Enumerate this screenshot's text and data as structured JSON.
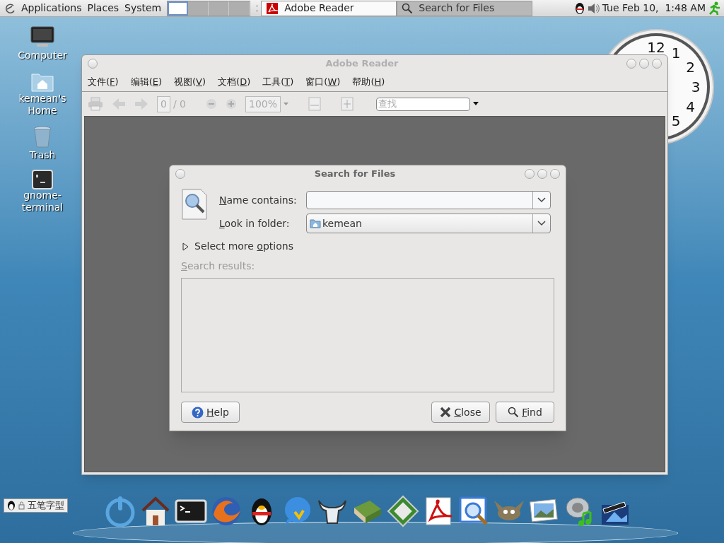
{
  "top_panel": {
    "menus": [
      {
        "label": "Applications"
      },
      {
        "label": "Places"
      },
      {
        "label": "System"
      }
    ],
    "workspaces": [
      {
        "selected": true
      },
      {
        "selected": false
      },
      {
        "selected": false
      },
      {
        "selected": false
      }
    ],
    "tasks": [
      {
        "label": "Adobe Reader",
        "kind": "pdf",
        "selected": false
      },
      {
        "label": "Search for Files",
        "kind": "search",
        "selected": true
      }
    ],
    "clock": "Tue Feb 10,  1:48 AM"
  },
  "desktop_icons": [
    {
      "label": "Computer",
      "kind": "computer"
    },
    {
      "label": "kemean's Home",
      "kind": "home"
    },
    {
      "label": "Trash",
      "kind": "trash"
    },
    {
      "label": "gnome-terminal",
      "kind": "terminal"
    }
  ],
  "clock_widget": {
    "numerals": [
      "12",
      "1",
      "2",
      "3",
      "4",
      "5"
    ]
  },
  "adobe_window": {
    "title": "Adobe Reader",
    "menu": [
      {
        "pre": "文件(",
        "key": "F",
        "post": ")"
      },
      {
        "pre": "编辑(",
        "key": "E",
        "post": ")"
      },
      {
        "pre": "视图(",
        "key": "V",
        "post": ")"
      },
      {
        "pre": "文档(",
        "key": "D",
        "post": ")"
      },
      {
        "pre": "工具(",
        "key": "T",
        "post": ")"
      },
      {
        "pre": "窗口(",
        "key": "W",
        "post": ")"
      },
      {
        "pre": "帮助(",
        "key": "H",
        "post": ")"
      }
    ],
    "toolbar": {
      "page": "0",
      "page_total": "/ 0",
      "zoom": "100%",
      "search_placeholder": "查找",
      "disabled": true
    }
  },
  "search_dialog": {
    "title": "Search for Files",
    "name_label": {
      "key": "N",
      "post": "ame contains:"
    },
    "folder_label": {
      "key": "L",
      "post": "ook in folder:"
    },
    "folder_value": "kemean",
    "more_options": {
      "pre": "Select more ",
      "key": "o",
      "post": "ptions",
      "expanded": false
    },
    "results_label": {
      "key": "S",
      "post": "earch results:",
      "disabled": true
    },
    "buttons": [
      {
        "key": "H",
        "post": "elp",
        "kind": "help"
      },
      {
        "key": "C",
        "post": "lose",
        "kind": "close"
      },
      {
        "key": "F",
        "post": "ind",
        "kind": "find"
      }
    ]
  },
  "input_method": {
    "label": "五笔字型"
  }
}
